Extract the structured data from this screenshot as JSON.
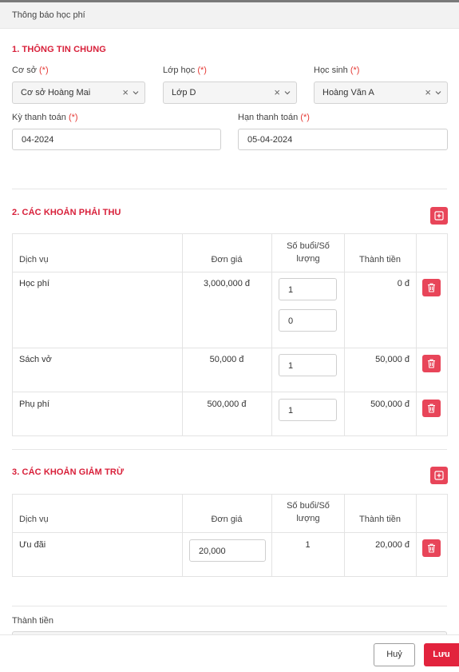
{
  "modal": {
    "title": "Thông báo học phí"
  },
  "general": {
    "title": "1. THÔNG TIN CHUNG",
    "required_mark": "(*)",
    "campus": {
      "label": "Cơ sở",
      "value": "Cơ sở Hoàng Mai"
    },
    "class": {
      "label": "Lớp học",
      "value": "Lớp D"
    },
    "student": {
      "label": "Học sinh",
      "value": "Hoàng Văn A"
    },
    "period": {
      "label": "Kỳ thanh toán",
      "value": "04-2024"
    },
    "deadline": {
      "label": "Hạn thanh toán",
      "value": "05-04-2024"
    },
    "clear_glyph": "×"
  },
  "receivables": {
    "title": "2. CÁC KHOẢN PHẢI THU",
    "headers": {
      "service": "Dịch vụ",
      "unit_price": "Đơn giá",
      "quantity": "Số buổi/Số lượng",
      "amount": "Thành tiền"
    },
    "rows": [
      {
        "service": "Học phí",
        "unit_price": "3,000,000 đ",
        "quantity": "1",
        "quantity_2": "0",
        "amount": "0 đ"
      },
      {
        "service": "Sách vở",
        "unit_price": "50,000 đ",
        "quantity": "1",
        "amount": "50,000 đ"
      },
      {
        "service": "Phụ phí",
        "unit_price": "500,000 đ",
        "quantity": "1",
        "amount": "500,000 đ"
      }
    ]
  },
  "deductions": {
    "title": "3. CÁC KHOẢN GIẢM TRỪ",
    "headers": {
      "service": "Dịch vụ",
      "unit_price": "Đơn giá",
      "quantity": "Số buổi/Số lượng",
      "amount": "Thành tiền"
    },
    "rows": [
      {
        "service": "Ưu đãi",
        "unit_price": "20,000",
        "quantity": "1",
        "amount": "20,000 đ"
      }
    ]
  },
  "total": {
    "label": "Thành tiền"
  },
  "actions": {
    "cancel": "Huỷ",
    "save": "Lưu"
  },
  "colors": {
    "accent": "#e2233d",
    "section_title": "#d8203a",
    "button_red": "#e84559"
  },
  "icons": {
    "add": "plus-square-icon",
    "delete": "trash-icon",
    "clear": "close-icon",
    "dropdown": "chevron-down-icon"
  }
}
